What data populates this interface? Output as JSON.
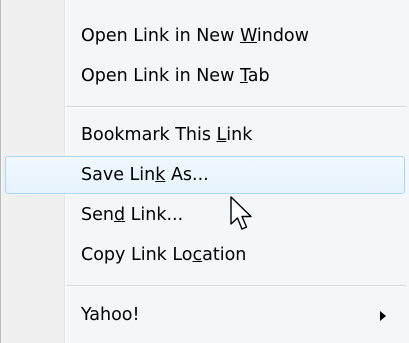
{
  "menu": {
    "items": [
      {
        "before": "Open Link in New ",
        "key": "W",
        "after": "indow"
      },
      {
        "before": "Open Link in New ",
        "key": "T",
        "after": "ab"
      },
      {
        "before": "Bookmark This ",
        "key": "L",
        "after": "ink"
      },
      {
        "before": "Save Lin",
        "key": "k",
        "after": " As..."
      },
      {
        "before": "Sen",
        "key": "d",
        "after": " Link..."
      },
      {
        "before": "Copy Link Lo",
        "key": "c",
        "after": "ation"
      },
      {
        "before": "Yahoo!",
        "key": "",
        "after": ""
      }
    ]
  },
  "colors": {
    "hover_border": "#a8d8f6",
    "hover_fill": "#e6f2fc"
  },
  "icons": {
    "submenu": "triangle-right-icon",
    "cursor": "mouse-pointer-icon"
  }
}
